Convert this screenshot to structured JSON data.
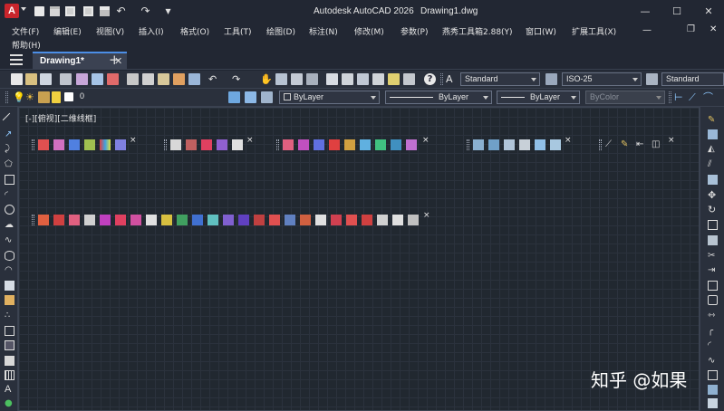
{
  "app": {
    "title": "Autodesk AutoCAD 2026",
    "document": "Drawing1.dwg",
    "logo_letter": "A",
    "accent": "#c9252c"
  },
  "window_controls": {
    "minimize": "—",
    "maximize": "☐",
    "close": "✕"
  },
  "doc_controls": {
    "minimize": "—",
    "restore": "❐",
    "close": "✕"
  },
  "menu": {
    "items": [
      "文件(F)",
      "编辑(E)",
      "视图(V)",
      "插入(I)",
      "格式(O)",
      "工具(T)",
      "绘图(D)",
      "标注(N)",
      "修改(M)",
      "参数(P)",
      "燕秀工具箱2.88(Y)",
      "窗口(W)",
      "扩展工具(X)"
    ],
    "second_row": "帮助(H)"
  },
  "tabs": {
    "active_label": "Drawing1*",
    "close_glyph": "✕",
    "new_glyph": "+"
  },
  "styles_toolbar": {
    "text_style": "Standard",
    "dim_style": "ISO-25",
    "table_style": "Standard"
  },
  "layers_toolbar": {
    "current_layer": "0",
    "color": "ByLayer",
    "linetype": "ByLayer",
    "lineweight": "ByLayer",
    "plot_style": "ByColor"
  },
  "viewport": {
    "label": "[-][俯视][二维线框]"
  },
  "floating_close_glyph": "×",
  "watermark": "知乎 @如果"
}
